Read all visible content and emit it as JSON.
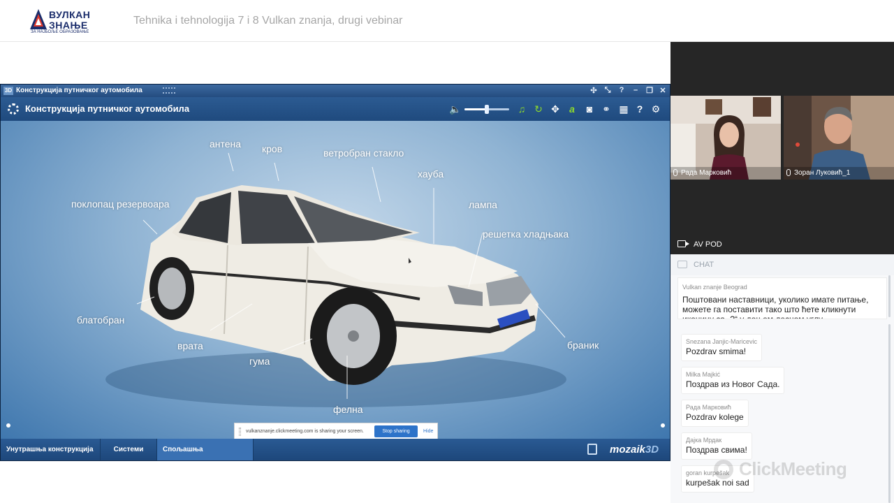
{
  "header": {
    "logo_line1": "ВУЛКАН",
    "logo_line2": "ЗНАЊЕ",
    "logo_line3": "ЗА НАЈБОЉЕ ОБРАЗОВАЊЕ",
    "webinar_title": "Tehnika i tehnologija 7 i 8 Vulkan znanja, drugi vebinar"
  },
  "app": {
    "window_title": "Конструкција путничког аутомобила",
    "window_badge": "3D",
    "heading": "Конструкција путничког аутомобила",
    "volume_level": 0.5,
    "toolbar_icons": [
      "speaker-icon",
      "music-icon",
      "rotate-icon",
      "move-icon",
      "text-icon",
      "camera-icon",
      "link-icon",
      "grid-icon",
      "help-icon",
      "settings-icon"
    ],
    "window_buttons": [
      "pin-icon",
      "fullscreen-icon",
      "help-icon",
      "minimize-icon",
      "restore-icon",
      "close-icon"
    ],
    "part_labels": [
      "антена",
      "кров",
      "ветробран стакло",
      "хауба",
      "поклопац резервоара",
      "лампа",
      "решетка хладњака",
      "блатобран",
      "врата",
      "гума",
      "браник",
      "фелна"
    ],
    "tabs": [
      "Унутрашња конструкција",
      "Системи",
      "Спољашња конструкција"
    ],
    "active_tab": 2,
    "brand_main": "mozaik",
    "brand_3d": "3D"
  },
  "share_bar": {
    "text": "vulkanznanje.clickmeeting.com is sharing your screen.",
    "stop_label": "Stop sharing",
    "hide_label": "Hide"
  },
  "videos": [
    {
      "name": "Рада Марковић"
    },
    {
      "name": "Зоран Луковић_1"
    }
  ],
  "av_pod_label": "AV POD",
  "chat": {
    "title": "CHAT",
    "pinned": {
      "author": "Vulkan znanje Beograd",
      "text": "Поштовани наставници, уколико имате питање, можете га поставити тако што ћете кликнути иконицу са „?“ у доњем десном углу"
    },
    "messages": [
      {
        "author": "Snezana Janjic-Maricevic",
        "text": "Pozdrav smima!"
      },
      {
        "author": "Milka Majkić",
        "text": "Поздрав из Новог Сада."
      },
      {
        "author": "Рада Марковић",
        "text": "Pozdrav kolege"
      },
      {
        "author": "Дајка Мрдак",
        "text": "Поздрав свима!"
      },
      {
        "author": "goran kurpešak",
        "text": "kurpešak noi sad"
      }
    ],
    "watermark": "ClickMeeting"
  },
  "colors": {
    "app_blue": "#1f4a7e",
    "accent_green": "#8fdc2a",
    "stop_button": "#2d73c9",
    "chat_bg": "#f7f8fa"
  }
}
